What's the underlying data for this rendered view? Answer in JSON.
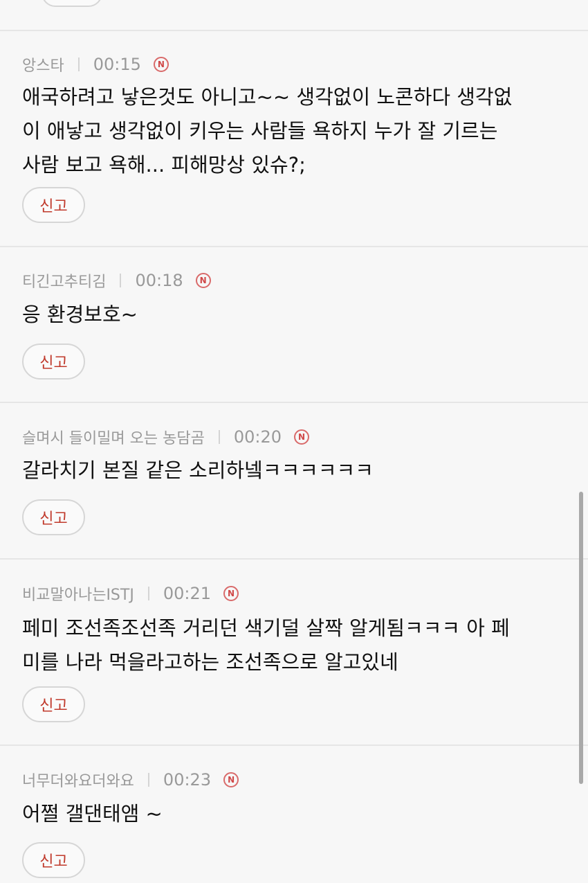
{
  "comments": [
    {
      "author": "앙스타",
      "time": "00:15",
      "badge": "N",
      "text": "애국하려고 낳은것도 아니고~~ 생각없이 노콘하다 생각없\n이 애낳고 생각없이 키우는 사람들 욕하지 누가 잘 기르는\n사람 보고 욕해... 피해망상 있슈?;",
      "report_label": "신고"
    },
    {
      "author": "티긴고추티김",
      "time": "00:18",
      "badge": "N",
      "text": "응 환경보호~",
      "report_label": "신고"
    },
    {
      "author": "슬며시 들이밀며 오는 농담곰",
      "time": "00:20",
      "badge": "N",
      "text": "갈라치기 본질 같은 소리하넼ㅋㅋㅋㅋㅋㅋ",
      "report_label": "신고"
    },
    {
      "author": "비교말아나는ISTJ",
      "time": "00:21",
      "badge": "N",
      "text": "페미 조선족조선족 거리던 색기덜 살짝 알게됨ㅋㅋㅋ 아 페\n미를 나라 먹을라고하는 조선족으로 알고있네",
      "report_label": "신고"
    },
    {
      "author": "너무더와요더와요",
      "time": "00:23",
      "badge": "N",
      "text": "어쩔 갤댄태앰 ~",
      "report_label": "신고"
    }
  ]
}
